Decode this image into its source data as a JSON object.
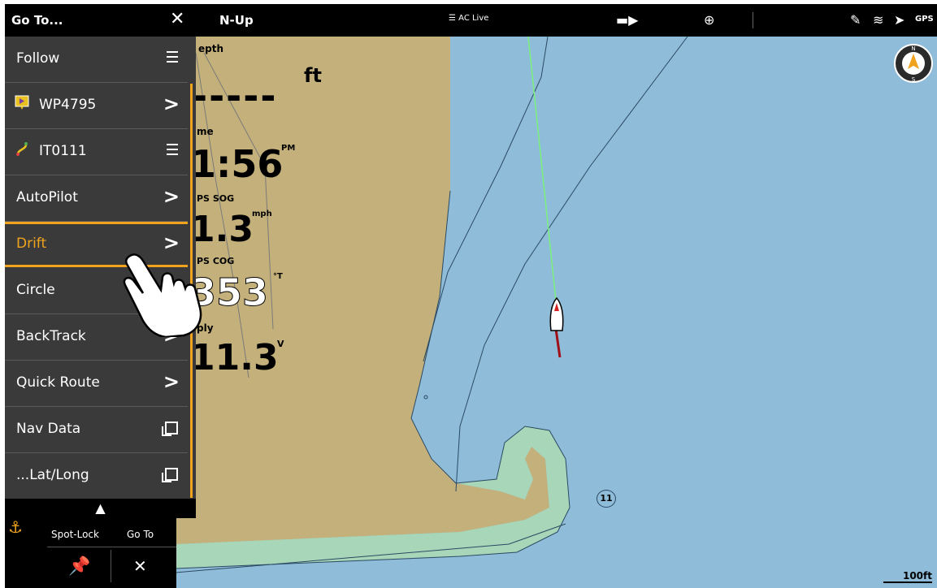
{
  "topbar": {
    "menu_title": "Go To...",
    "close_icon": "close-icon",
    "orientation": "N-Up",
    "ac_live": "AC Live",
    "gps": "GPS"
  },
  "menu": {
    "items": [
      {
        "label": "Follow",
        "icon": "",
        "action": "hamburger"
      },
      {
        "label": "WP4795",
        "icon": "waypoint-icon",
        "action": "arrow"
      },
      {
        "label": "IT0111",
        "icon": "track-icon",
        "action": "hamburger"
      },
      {
        "label": "AutoPilot",
        "icon": "",
        "action": "arrow"
      },
      {
        "label": "Drift",
        "icon": "",
        "action": "arrow"
      },
      {
        "label": "Circle",
        "icon": "",
        "action": "arrow"
      },
      {
        "label": "BackTrack",
        "icon": "",
        "action": "arrow"
      },
      {
        "label": "Quick Route",
        "icon": "",
        "action": "arrow"
      },
      {
        "label": "Nav Data",
        "icon": "",
        "action": "window"
      },
      {
        "label": "...Lat/Long",
        "icon": "",
        "action": "window"
      }
    ],
    "arrow_glyph": ">",
    "scroll_up": "^"
  },
  "overlays": {
    "depth_label": "epth",
    "depth_unit": "ft",
    "depth_value": "-----",
    "time_label": "me",
    "time_value": "1:56",
    "time_suffix": "PM",
    "sog_label": "PS SOG",
    "sog_value": "1.3",
    "sog_unit": "mph",
    "cog_label": "PS COG",
    "cog_value": "353",
    "cog_unit": "°T",
    "volt_label": "ply",
    "volt_value": "11.3",
    "volt_unit": "V"
  },
  "bottom": {
    "spot_lock": "Spot-Lock",
    "go_to": "Go To"
  },
  "scale": "100ft",
  "marker": "11",
  "colors": {
    "accent": "#f0a31c",
    "water": "#8fbcd9",
    "land": "#c4b07a",
    "shallow": "#a8d6b8"
  }
}
